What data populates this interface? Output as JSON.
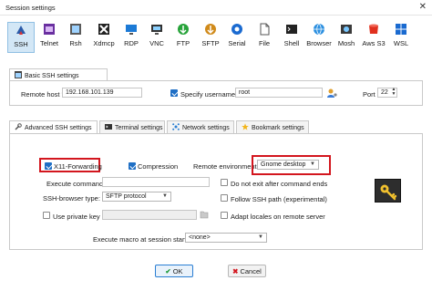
{
  "window": {
    "title": "Session settings",
    "close_glyph": "✕"
  },
  "protocols": [
    {
      "label": "SSH",
      "icon": "ssh-icon",
      "active": true
    },
    {
      "label": "Telnet",
      "icon": "telnet-icon",
      "active": false
    },
    {
      "label": "Rsh",
      "icon": "rsh-icon",
      "active": false
    },
    {
      "label": "Xdmcp",
      "icon": "xdmcp-icon",
      "active": false
    },
    {
      "label": "RDP",
      "icon": "rdp-icon",
      "active": false
    },
    {
      "label": "VNC",
      "icon": "vnc-icon",
      "active": false
    },
    {
      "label": "FTP",
      "icon": "ftp-icon",
      "active": false
    },
    {
      "label": "SFTP",
      "icon": "sftp-icon",
      "active": false
    },
    {
      "label": "Serial",
      "icon": "serial-icon",
      "active": false
    },
    {
      "label": "File",
      "icon": "file-icon",
      "active": false
    },
    {
      "label": "Shell",
      "icon": "shell-icon",
      "active": false
    },
    {
      "label": "Browser",
      "icon": "browser-icon",
      "active": false
    },
    {
      "label": "Mosh",
      "icon": "mosh-icon",
      "active": false
    },
    {
      "label": "Aws S3",
      "icon": "aws-s3-icon",
      "active": false
    },
    {
      "label": "WSL",
      "icon": "wsl-icon",
      "active": false
    }
  ],
  "basic": {
    "tab_label": "Basic SSH settings",
    "remote_host_label": "Remote host *",
    "remote_host_value": "192.168.101.139",
    "specify_username_label": "Specify username",
    "specify_username_checked": true,
    "username_value": "root",
    "port_label": "Port",
    "port_value": "22"
  },
  "tabs": [
    {
      "label": "Advanced SSH settings",
      "icon": "wrench-icon",
      "active": true
    },
    {
      "label": "Terminal settings",
      "icon": "terminal-icon",
      "active": false
    },
    {
      "label": "Network settings",
      "icon": "network-icon",
      "active": false
    },
    {
      "label": "Bookmark settings",
      "icon": "star-icon",
      "active": false
    }
  ],
  "advanced": {
    "x11_label": "X11-Forwarding",
    "x11_checked": true,
    "compression_label": "Compression",
    "compression_checked": true,
    "remote_env_label": "Remote environment:",
    "remote_env_value": "Gnome desktop",
    "execute_command_label": "Execute command:",
    "execute_command_value": "",
    "do_not_exit_label": "Do not exit after command ends",
    "browser_type_label": "SSH-browser type:",
    "browser_type_value": "SFTP protocol",
    "follow_ssh_label": "Follow SSH path (experimental)",
    "use_private_key_label": "Use private key",
    "adapt_locales_label": "Adapt locales on remote server",
    "execute_macro_label": "Execute macro at session start:",
    "execute_macro_value": "<none>"
  },
  "buttons": {
    "ok_label": "OK",
    "cancel_label": "Cancel"
  },
  "colors": {
    "highlight_red": "#d3161e",
    "accent_blue": "#1f6fc5",
    "active_proto_bg": "#d3e7f6"
  }
}
